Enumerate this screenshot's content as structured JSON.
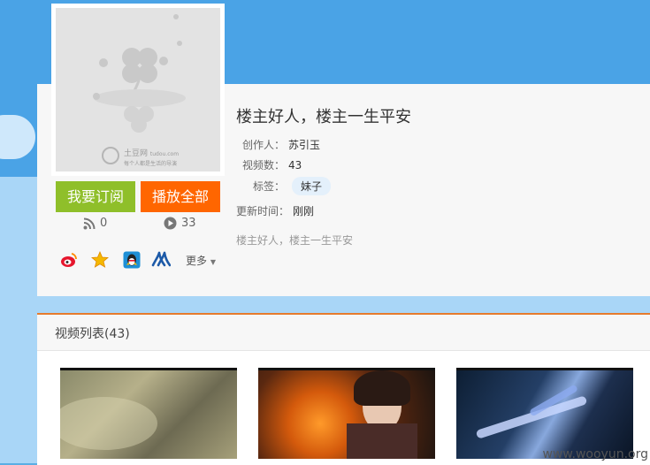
{
  "playlist": {
    "title": "楼主好人，楼主一生平安",
    "creator_label": "创作人：",
    "creator_value": "苏引玉",
    "video_count_label": "视频数：",
    "video_count_value": "43",
    "tag_label": "标签：",
    "tag_value": "妹子",
    "updated_label": "更新时间：",
    "updated_value": "刚刚",
    "description": "楼主好人，楼主一生平安"
  },
  "cover": {
    "brand": "土豆网",
    "brand_domain": "tudou.com",
    "slogan": "每个人都是生活的导演"
  },
  "actions": {
    "subscribe_label": "我要订阅",
    "play_all_label": "播放全部",
    "rss_count": "0",
    "play_count": "33",
    "more_label": "更多"
  },
  "share_icons": [
    "weibo-icon",
    "qzone-star-icon",
    "qq-penguin-icon",
    "renren-icon"
  ],
  "video_list": {
    "title": "视频列表(43)"
  },
  "watermark": "www.wooyun.org",
  "colors": {
    "subscribe": "#8fbf2a",
    "play_all": "#ff6600",
    "sky": "#4aa3e6",
    "accent_line": "#e67c2e"
  }
}
